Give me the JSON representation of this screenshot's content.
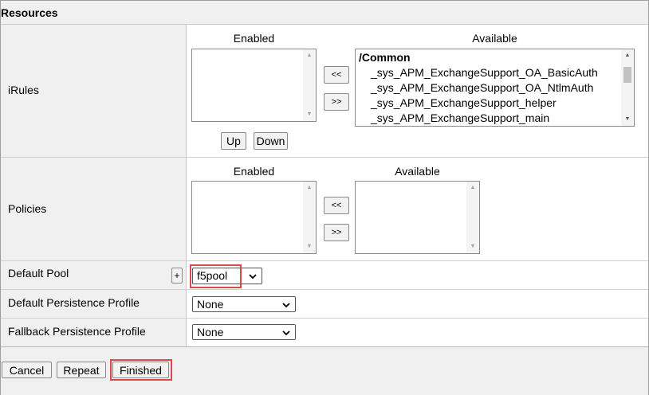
{
  "section": {
    "title": "Resources"
  },
  "irules": {
    "label": "iRules",
    "enabled_caption": "Enabled",
    "available_caption": "Available",
    "move_left": "<<",
    "move_right": ">>",
    "up": "Up",
    "down": "Down",
    "available_items": [
      "/Common",
      "_sys_APM_ExchangeSupport_OA_BasicAuth",
      "_sys_APM_ExchangeSupport_OA_NtlmAuth",
      "_sys_APM_ExchangeSupport_helper",
      "_sys_APM_ExchangeSupport_main"
    ]
  },
  "policies": {
    "label": "Policies",
    "enabled_caption": "Enabled",
    "available_caption": "Available",
    "move_left": "<<",
    "move_right": ">>"
  },
  "default_pool": {
    "label": "Default Pool",
    "add": "+",
    "value": "f5pool"
  },
  "default_persistence": {
    "label": "Default Persistence Profile",
    "value": "None"
  },
  "fallback_persistence": {
    "label": "Fallback Persistence Profile",
    "value": "None"
  },
  "footer": {
    "cancel": "Cancel",
    "repeat": "Repeat",
    "finished": "Finished"
  },
  "colors": {
    "highlight": "#e04848",
    "label_bg": "#f0f0f0"
  },
  "icons": {
    "dropdown": "chevron-down-icon",
    "scroll_up": "scroll-up-arrow-icon",
    "scroll_down": "scroll-down-arrow-icon"
  }
}
